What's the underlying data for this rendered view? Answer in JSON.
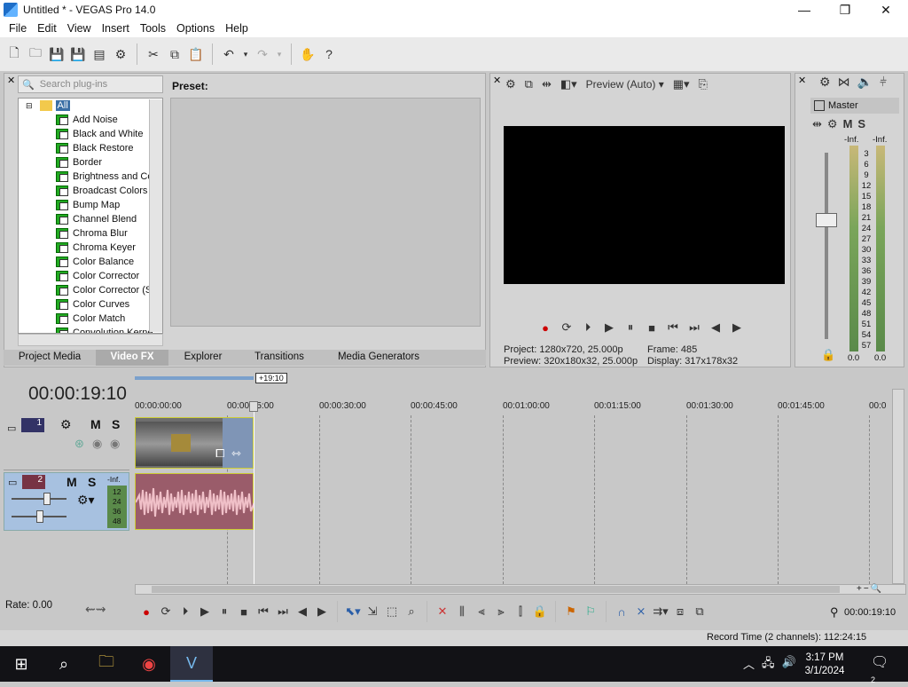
{
  "window": {
    "title": "Untitled * - VEGAS Pro 14.0",
    "min": "—",
    "max": "❐",
    "close": "✕"
  },
  "menu": [
    "File",
    "Edit",
    "View",
    "Insert",
    "Tools",
    "Options",
    "Help"
  ],
  "fx": {
    "search_placeholder": "Search plug-ins",
    "root": "All",
    "items": [
      "Add Noise",
      "Black and White",
      "Black Restore",
      "Border",
      "Brightness and Co",
      "Broadcast Colors",
      "Bump Map",
      "Channel Blend",
      "Chroma Blur",
      "Chroma Keyer",
      "Color Balance",
      "Color Corrector",
      "Color Corrector (S",
      "Color Curves",
      "Color Match",
      "Convolution Kerne"
    ],
    "preset_label": "Preset:"
  },
  "tabs": [
    "Project Media",
    "Video FX",
    "Explorer",
    "Transitions",
    "Media Generators"
  ],
  "active_tab": "Video FX",
  "preview": {
    "mode": "Preview (Auto)",
    "project_label": "Project:",
    "project_value": "1280x720, 25.000p",
    "preview_label": "Preview:",
    "preview_value": "320x180x32, 25.000p",
    "frame_label": "Frame:",
    "frame_value": "485",
    "display_label": "Display:",
    "display_value": "317x178x32"
  },
  "master": {
    "title": "Master",
    "m": "M",
    "s": "S",
    "inf_l": "-Inf.",
    "inf_r": "-Inf.",
    "scale": [
      "3",
      "6",
      "9",
      "12",
      "15",
      "18",
      "21",
      "24",
      "27",
      "30",
      "33",
      "36",
      "39",
      "42",
      "45",
      "48",
      "51",
      "54",
      "57"
    ],
    "bottom_l": "0.0",
    "bottom_r": "0.0"
  },
  "timeline": {
    "timecode": "00:00:19:10",
    "region_label": "+19:10",
    "ruler": [
      "00:00:00:00",
      "00:00:15:00",
      "00:00:30:00",
      "00:00:45:00",
      "00:01:00:00",
      "00:01:15:00",
      "00:01:30:00",
      "00:01:45:00",
      "00:0"
    ],
    "track1": {
      "num": "1",
      "m": "M",
      "s": "S"
    },
    "track2": {
      "num": "2",
      "m": "M",
      "s": "S",
      "inf": "-Inf.",
      "levels": [
        "12",
        "24",
        "36",
        "48"
      ]
    },
    "rate": "Rate: 0.00",
    "cursor_time": "00:00:19:10",
    "record_time": "Record Time (2 channels): 112:24:15"
  },
  "taskbar": {
    "time": "3:17 PM",
    "date": "3/1/2024",
    "notifications": "2"
  }
}
